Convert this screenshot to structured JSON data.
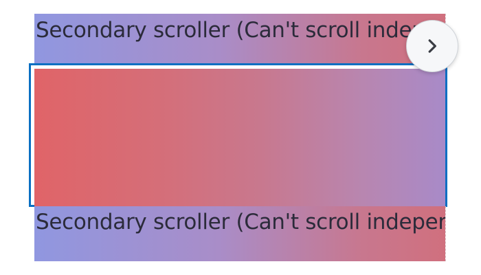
{
  "secondary_top": {
    "label": "Secondary scroller (Can't scroll independently)"
  },
  "secondary_bottom": {
    "label": "Secondary scroller (Can't scroll independently)"
  },
  "primary": {
    "focus_color": "#0a6fc2"
  },
  "next_button": {
    "icon": "chevron-right-icon"
  }
}
